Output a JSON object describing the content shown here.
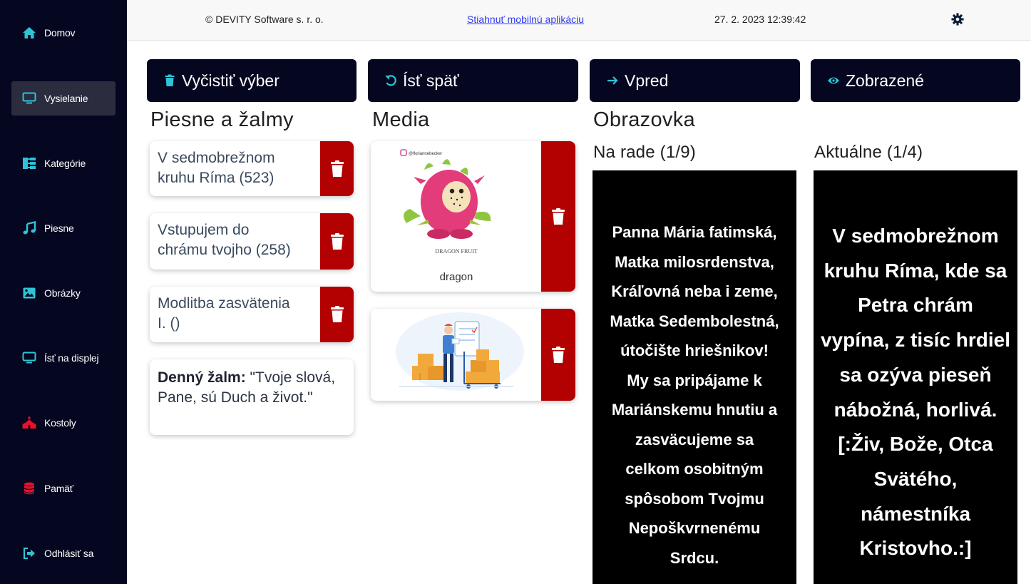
{
  "sidebar": {
    "items": [
      {
        "label": "Domov",
        "icon": "home-icon"
      },
      {
        "label": "Vysielanie",
        "icon": "monitor-icon"
      },
      {
        "label": "Kategórie",
        "icon": "sitemap-icon"
      },
      {
        "label": "Piesne",
        "icon": "music-icon"
      },
      {
        "label": "Obrázky",
        "icon": "image-icon"
      },
      {
        "label": "Ísť na displej",
        "icon": "monitor-icon"
      },
      {
        "label": "Kostoly",
        "icon": "church-icon"
      },
      {
        "label": "Pamäť",
        "icon": "database-icon"
      },
      {
        "label": "Odhlásiť sa",
        "icon": "logout-icon"
      }
    ]
  },
  "header": {
    "copyright": "© DEVITY Software s. r. o.",
    "mobile_link": "Stiahnuť mobilnú aplikáciu",
    "datetime": "27. 2. 2023 12:39:42",
    "settings_icon": "gear-icon"
  },
  "toolbar": {
    "clear_label": "Vyčistiť výber",
    "back_label": "Ísť späť",
    "forward_label": "Vpred",
    "shown_label": "Zobrazené"
  },
  "songs": {
    "title": "Piesne a žalmy",
    "items": [
      "V sedmobrežnom\nkruhu Ríma (523)",
      "Vstupujem do\nchrámu tvojho (258)",
      "Modlitba zasvätenia\nI. ()"
    ],
    "psalm_label": "Denný žalm:",
    "psalm_text": " \"Tvoje slová, Pane, sú Duch a život.\""
  },
  "media": {
    "title": "Media",
    "items": [
      {
        "handle": "@floriannebecker",
        "caption_small": "DRAGON FRUIT",
        "caption": "dragon"
      },
      {
        "caption": ""
      }
    ]
  },
  "screen": {
    "title": "Obrazovka",
    "next_label": "Na rade (1/9)",
    "next_text": "Panna Mária fatimská,\nMatka milosrdenstva,\nKráľovná neba i zeme,\nMatka Sedembolestná,\nútočište hriešnikov!\nMy sa pripájame k\nMariánskemu hnutiu a\nzasväcujeme sa\ncelkom osobitným\nspôsobom Tvojmu\nNepoškvrnenému\nSrdcu.",
    "current_label": "Aktuálne (1/4)",
    "current_text": "V sedmobrežnom\nkruhu Ríma, kde sa\nPetra chrám\nvypína, z tisíc hrdiel\nsa ozýva pieseň\nnábožná, horlivá.\n[:Živ, Bože, Otca\nSvätého,\nnámestníka\nKristovho.:]"
  },
  "colors": {
    "sidebar_bg": "#050620",
    "accent_icon": "#2ec4d6",
    "delete_red": "#b30000"
  }
}
